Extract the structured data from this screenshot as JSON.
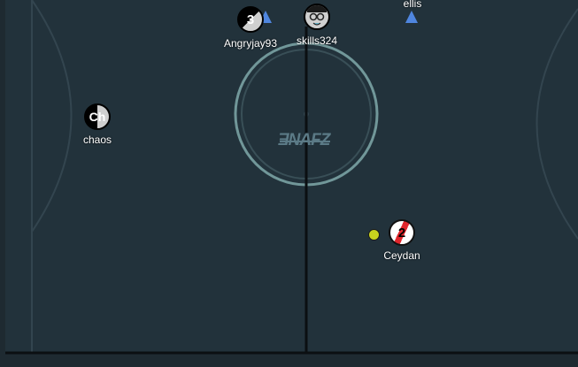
{
  "colors": {
    "pitch": "#22323b",
    "outside": "#1e2a31",
    "line": "#33454f",
    "center_circle": "#7fa9aa",
    "center_line": "#0b0f12",
    "team_blue": "#4f86df",
    "ball": "#c8d21e"
  },
  "logo": {
    "text": "ƎNAFZ"
  },
  "players": [
    {
      "id": "angryjay93",
      "name": "Angryjay93",
      "badge": "3",
      "style": "half-black-white"
    },
    {
      "id": "skills324",
      "name": "skills324",
      "badge": "",
      "style": "face-avatar"
    },
    {
      "id": "ellis",
      "name": "ellis",
      "badge": "",
      "style": "triangle-only"
    },
    {
      "id": "chaos",
      "name": "chaos",
      "badge": "Ch",
      "style": "black-white"
    },
    {
      "id": "ceydan",
      "name": "Ceydan",
      "badge": "2",
      "style": "red-white"
    }
  ],
  "ball": {
    "icon": "ball-icon"
  }
}
